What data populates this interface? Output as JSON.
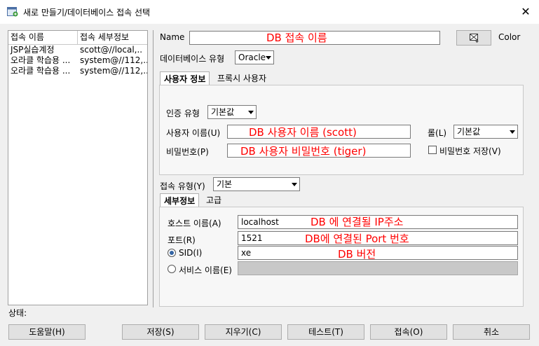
{
  "window": {
    "title": "새로 만들기/데이터베이스 접속 선택",
    "close_glyph": "✕"
  },
  "connection_list": {
    "headers": [
      "접속 이름",
      "접속 세부정보"
    ],
    "rows": [
      [
        "JSP실습계정",
        "scott@//local,.."
      ],
      [
        "오라클 학습용 ...",
        "system@//112,..."
      ],
      [
        "오라클 학습용 ...",
        "system@//112,..."
      ]
    ]
  },
  "form": {
    "name_label": "Name",
    "name_value": "",
    "color_label": "Color",
    "db_type_label": "데이터베이스 유형",
    "db_type_value": "Oracle",
    "tabs": [
      "사용자 정보",
      "프록시 사용자"
    ],
    "auth_type_label": "인증 유형",
    "auth_type_value": "기본값",
    "username_label": "사용자 이름(U)",
    "username_value": "",
    "role_label": "롤(L)",
    "role_value": "기본값",
    "password_label": "비밀번호(P)",
    "password_value": "",
    "save_password_label": "비밀번호 저장(V)",
    "save_password_checked": false,
    "conn_type_label": "접속 유형(Y)",
    "conn_type_value": "기본",
    "detail_tabs": [
      "세부정보",
      "고급"
    ],
    "host_label": "호스트 이름(A)",
    "host_value": "localhost",
    "port_label": "포트(R)",
    "port_value": "1521",
    "sid_label": "SID(I)",
    "sid_value": "xe",
    "service_label": "서비스 이름(E)",
    "service_value": "",
    "selected_radio": "sid"
  },
  "annotations": {
    "name": "DB 접속 이름",
    "username": "DB 사용자 이름 (scott)",
    "password": "DB 사용자 비밀번호 (tiger)",
    "host": "DB 에 연결될 IP주소",
    "port": "DB에 연결된 Port 번호",
    "sid": "DB 버전",
    "color": "#ff0000"
  },
  "status_label": "상태:",
  "buttons": {
    "help": "도움말(H)",
    "save": "저장(S)",
    "clear": "지우기(C)",
    "test": "테스트(T)",
    "connect": "접속(O)",
    "cancel": "취소"
  },
  "icons": {
    "app": "db-connection-icon",
    "color_picker": "color-picker-icon"
  }
}
